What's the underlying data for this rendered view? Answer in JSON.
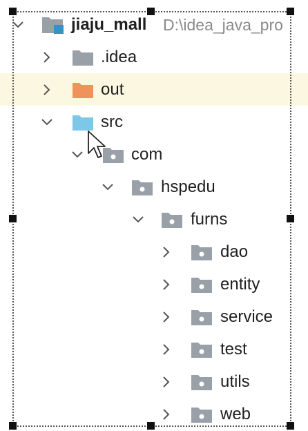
{
  "project_tree": {
    "root": {
      "name": "jiaju_mall",
      "path": "D:\\idea_java_pro"
    },
    "idea": {
      "name": ".idea"
    },
    "out": {
      "name": "out"
    },
    "src": {
      "name": "src"
    },
    "com": {
      "name": "com"
    },
    "hspedu": {
      "name": "hspedu"
    },
    "furns": {
      "name": "furns"
    },
    "dao": {
      "name": "dao"
    },
    "entity": {
      "name": "entity"
    },
    "service": {
      "name": "service"
    },
    "test": {
      "name": "test"
    },
    "utils": {
      "name": "utils"
    },
    "web": {
      "name": "web"
    }
  },
  "colors": {
    "folder_gray": "#9aa0a8",
    "folder_orange": "#f0935b",
    "folder_blue": "#7ec7e8",
    "module_blue": "#3592c4",
    "highlight_row": "#fbf7e1"
  },
  "icons": {
    "expand": "chevron-down-icon",
    "collapse": "chevron-right-icon",
    "folder": "folder-icon",
    "package": "package-icon",
    "module": "module-folder-icon"
  }
}
